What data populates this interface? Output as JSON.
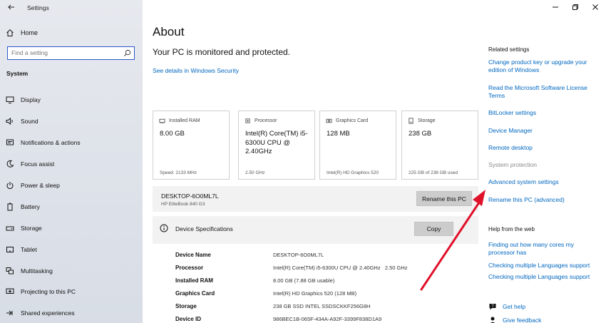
{
  "window": {
    "title": "Settings"
  },
  "sidebar": {
    "home_label": "Home",
    "search_placeholder": "Find a setting",
    "section_label": "System",
    "items": [
      {
        "label": "Display",
        "icon": "display-icon"
      },
      {
        "label": "Sound",
        "icon": "sound-icon"
      },
      {
        "label": "Notifications & actions",
        "icon": "notifications-icon"
      },
      {
        "label": "Focus assist",
        "icon": "focus-assist-icon"
      },
      {
        "label": "Power & sleep",
        "icon": "power-icon"
      },
      {
        "label": "Battery",
        "icon": "battery-icon"
      },
      {
        "label": "Storage",
        "icon": "storage-icon"
      },
      {
        "label": "Tablet",
        "icon": "tablet-icon"
      },
      {
        "label": "Multitasking",
        "icon": "multitasking-icon"
      },
      {
        "label": "Projecting to this PC",
        "icon": "projecting-icon"
      },
      {
        "label": "Shared experiences",
        "icon": "shared-experiences-icon"
      }
    ]
  },
  "main": {
    "title": "About",
    "status": "Your PC is monitored and protected.",
    "security_link": "See details in Windows Security",
    "cards": [
      {
        "heading": "Installed RAM",
        "value": "8.00 GB",
        "sub": "Speed: 2133 MHz",
        "icon": "ram-icon"
      },
      {
        "heading": "Processor",
        "value": "Intel(R) Core(TM) i5-6300U CPU @ 2.40GHz",
        "sub": "2.50 GHz",
        "icon": "processor-icon"
      },
      {
        "heading": "Graphics Card",
        "value": "128 MB",
        "sub": "Intel(R) HD Graphics 520",
        "icon": "graphics-card-icon"
      },
      {
        "heading": "Storage",
        "value": "238 GB",
        "sub": "225 GB of 238 GB used",
        "icon": "storage-drive-icon"
      }
    ],
    "device_name": "DESKTOP-6O0ML7L",
    "device_model": "HP EliteBook 840 G3",
    "rename_label": "Rename this PC",
    "specs_title": "Device Specifications",
    "copy_label": "Copy",
    "specs": [
      {
        "key": "Device Name",
        "value": "DESKTOP-6O0ML7L"
      },
      {
        "key": "Processor",
        "value": "Intel(R) Core(TM) i5-6300U CPU @ 2.40GHz   2.50 GHz"
      },
      {
        "key": "Installed RAM",
        "value": "8.00 GB (7.88 GB usable)"
      },
      {
        "key": "Graphics Card",
        "value": "Intel(R) HD Graphics 520 (128 MB)"
      },
      {
        "key": "Storage",
        "value": "238 GB SSD INTEL SSDSCKKF256G8H"
      },
      {
        "key": "Device ID",
        "value": "986BEC1B-065F-434A-A92F-3399F838D1A9"
      }
    ]
  },
  "related": {
    "heading": "Related settings",
    "links": [
      "Change product key or upgrade your edition of Windows",
      "Read the Microsoft Software License Terms",
      "BitLocker settings",
      "Device Manager",
      "Remote desktop",
      "System protection",
      "Advanced system settings",
      "Rename this PC (advanced)"
    ],
    "help_heading": "Help from the web",
    "help_links": [
      "Finding out how many cores my processor has",
      "Checking multiple Languages support",
      "Checking multiple Languages support"
    ],
    "get_help": "Get help",
    "give_feedback": "Give feedback"
  },
  "colors": {
    "accent": "#0067c0",
    "annotation_arrow": "#e0112b",
    "sidebar_bg": "#e1e5eb",
    "panel_bg": "#f2f2f2"
  }
}
